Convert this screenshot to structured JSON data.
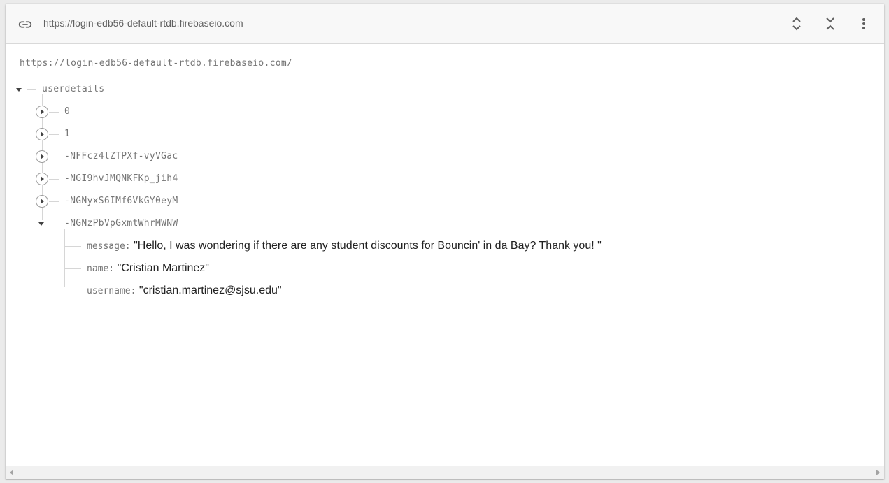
{
  "toolbar": {
    "link_icon": "link-icon",
    "url": "https://login-edb56-default-rtdb.firebaseio.com",
    "expand_icon": "expand-all-icon",
    "collapse_icon": "collapse-all-icon",
    "more_icon": "more-vert-icon"
  },
  "tree": {
    "root_url": "https://login-edb56-default-rtdb.firebaseio.com/",
    "node": "userdetails",
    "children": [
      "0",
      "1",
      "-NFFcz4lZTPXf-vyVGac",
      "-NGI9hvJMQNKFKp_jih4",
      "-NGNyxS6IMf6VkGY0eyM",
      "-NGNzPbVpGxmtWhrMWNW"
    ],
    "expanded_child_fields": [
      {
        "key": "message:",
        "value": "\"Hello, I was wondering if there are any student discounts for Bouncin' in da Bay? Thank you! \""
      },
      {
        "key": "name:",
        "value": "\"Cristian Martinez\""
      },
      {
        "key": "username:",
        "value": "\"cristian.martinez@sjsu.edu\""
      }
    ]
  },
  "colors": {
    "toolbar_bg": "#f8f8f8",
    "tree_line": "#d6d6d6",
    "key_text": "#757575",
    "value_text": "#212121"
  }
}
